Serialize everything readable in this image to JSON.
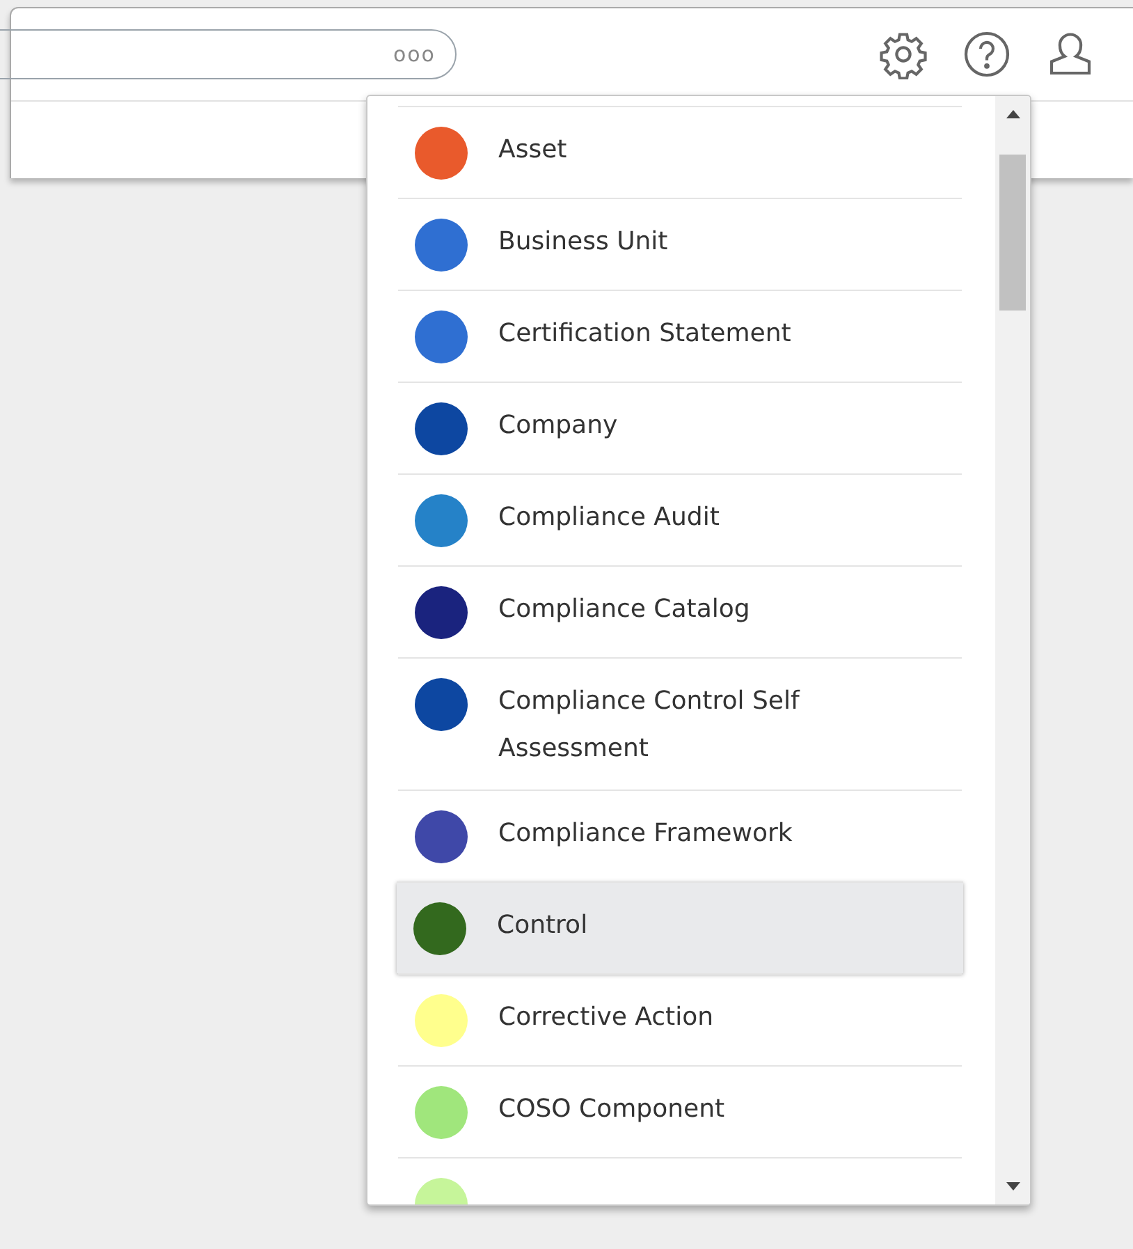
{
  "search": {
    "menu_glyph": "ooo"
  },
  "menu": {
    "items": [
      {
        "label": "Asset",
        "color": "#e95a2c",
        "selected": false
      },
      {
        "label": "Business Unit",
        "color": "#2f6fd2",
        "selected": false
      },
      {
        "label": "Certification Statement",
        "color": "#2f6fd2",
        "selected": false
      },
      {
        "label": "Company",
        "color": "#0d47a1",
        "selected": false
      },
      {
        "label": "Compliance Audit",
        "color": "#2582c8",
        "selected": false
      },
      {
        "label": "Compliance Catalog",
        "color": "#1a237e",
        "selected": false
      },
      {
        "label": "Compliance Control Self Assessment",
        "color": "#0d47a1",
        "selected": false
      },
      {
        "label": "Compliance Framework",
        "color": "#3f48a8",
        "selected": false
      },
      {
        "label": "Control",
        "color": "#33691e",
        "selected": true
      },
      {
        "label": "Corrective Action",
        "color": "#ffff8d",
        "selected": false
      },
      {
        "label": "COSO Component",
        "color": "#a0e67c",
        "selected": false
      },
      {
        "color": "#c6f59a",
        "selected": false
      }
    ]
  }
}
